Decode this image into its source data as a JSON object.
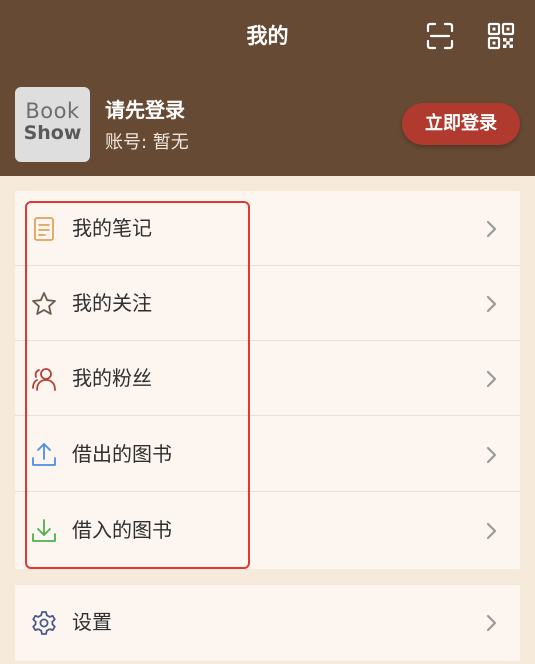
{
  "nav": {
    "title": "我的",
    "scan_icon": "scan-icon",
    "qr_icon": "qr-code-icon"
  },
  "profile": {
    "avatar_line1": "Book",
    "avatar_line2": "Show",
    "title": "请先登录",
    "account": "账号: 暂无",
    "login_button": "立即登录"
  },
  "menu": {
    "items": [
      {
        "label": "我的笔记",
        "icon": "note-icon",
        "color": "#e2a25a"
      },
      {
        "label": "我的关注",
        "icon": "star-icon",
        "color": "#6b5a4e"
      },
      {
        "label": "我的粉丝",
        "icon": "users-icon",
        "color": "#b0463a"
      },
      {
        "label": "借出的图书",
        "icon": "upload-icon",
        "color": "#4a90e2"
      },
      {
        "label": "借入的图书",
        "icon": "download-icon",
        "color": "#4caf50"
      }
    ]
  },
  "settings": {
    "label": "设置",
    "icon": "gear-icon"
  },
  "colors": {
    "header_bg": "#664a34",
    "login_button_bg": "#b03a2e",
    "page_bg": "#f6eadb",
    "highlight_border": "#e03a2e"
  }
}
